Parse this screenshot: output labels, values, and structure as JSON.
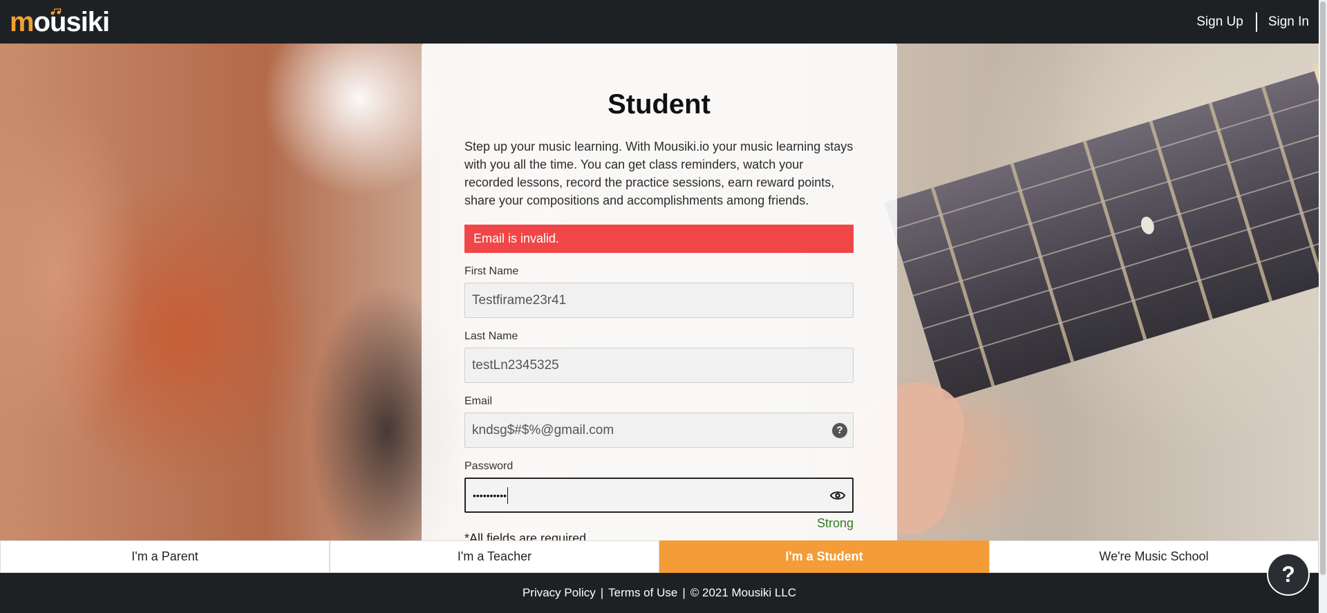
{
  "header": {
    "logo_first": "m",
    "logo_rest": "ousiki",
    "logo_text": "mousiki",
    "signup_label": "Sign Up",
    "signin_label": "Sign In"
  },
  "card": {
    "title": "Student",
    "description": "Step up your music learning. With Mousiki.io your music learning stays with you all the time. You can get class reminders, watch your recorded lessons, record the practice sessions, earn reward points, share your compositions and accomplishments among friends.",
    "alert": "Email is invalid.",
    "fields": {
      "first_name": {
        "label": "First Name",
        "value": "Testfirame23r41"
      },
      "last_name": {
        "label": "Last Name",
        "value": "testLn2345325"
      },
      "email": {
        "label": "Email",
        "value": "kndsg$#$%@gmail.com"
      },
      "password": {
        "label": "Password",
        "value": "••••••••••"
      }
    },
    "password_strength": "Strong",
    "required_note": "*All fields are required."
  },
  "roles": [
    {
      "label": "I'm a Parent",
      "active": false
    },
    {
      "label": "I'm a Teacher",
      "active": false
    },
    {
      "label": "I'm a Student",
      "active": true
    },
    {
      "label": "We're Music School",
      "active": false
    }
  ],
  "footer": {
    "privacy": "Privacy Policy",
    "separator": "|",
    "terms": "Terms of Use",
    "copyright": "© 2021 Mousiki LLC"
  },
  "help_bubble": "?",
  "colors": {
    "accent": "#f49c37",
    "alert": "#f14647",
    "strength": "#2e7d1e",
    "dark": "#1e2124"
  },
  "icons": {
    "email_help": "question-circle-icon",
    "password_toggle": "eye-icon"
  }
}
